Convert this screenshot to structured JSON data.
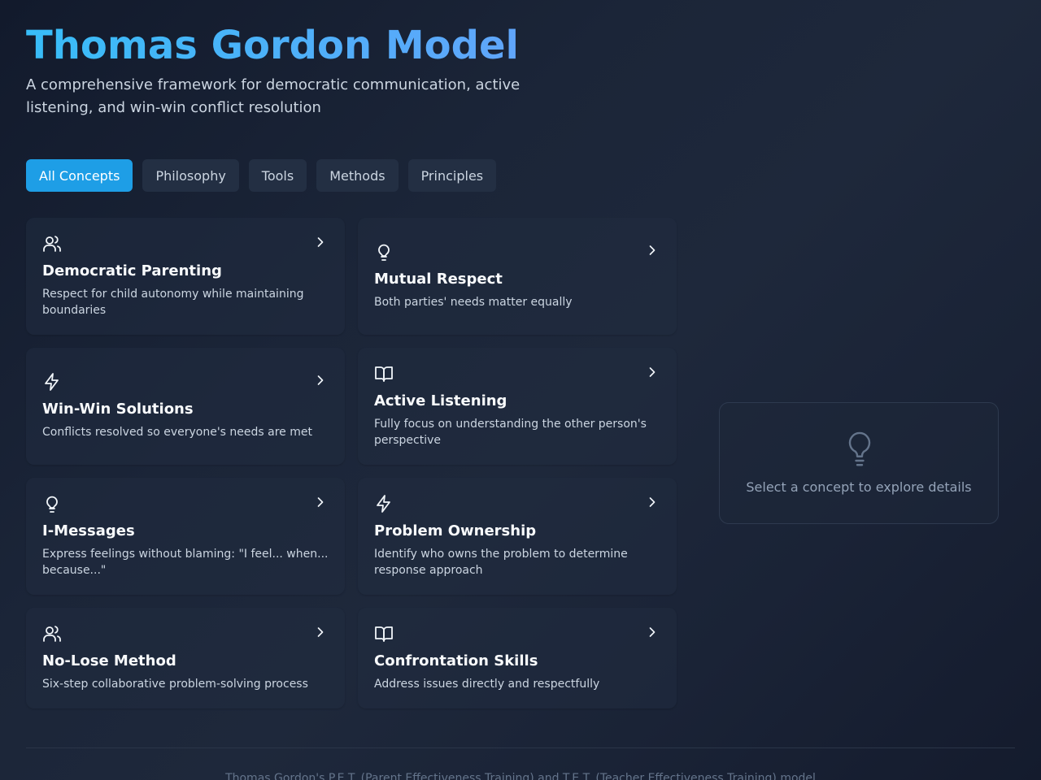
{
  "header": {
    "title": "Thomas Gordon Model",
    "subtitle": "A comprehensive framework for democratic communication, active listening, and win-win conflict resolution"
  },
  "filters": [
    {
      "label": "All Concepts",
      "active": true
    },
    {
      "label": "Philosophy",
      "active": false
    },
    {
      "label": "Tools",
      "active": false
    },
    {
      "label": "Methods",
      "active": false
    },
    {
      "label": "Principles",
      "active": false
    }
  ],
  "concepts": [
    {
      "title": "Democratic Parenting",
      "description": "Respect for child autonomy while maintaining boundaries",
      "icon": "users-icon"
    },
    {
      "title": "Mutual Respect",
      "description": "Both parties' needs matter equally",
      "icon": "lightbulb-icon"
    },
    {
      "title": "Win-Win Solutions",
      "description": "Conflicts resolved so everyone's needs are met",
      "icon": "lightning-icon"
    },
    {
      "title": "Active Listening",
      "description": "Fully focus on understanding the other person's perspective",
      "icon": "book-icon"
    },
    {
      "title": "I-Messages",
      "description": "Express feelings without blaming: \"I feel... when... because...\"",
      "icon": "lightbulb-icon"
    },
    {
      "title": "Problem Ownership",
      "description": "Identify who owns the problem to determine response approach",
      "icon": "lightning-icon"
    },
    {
      "title": "No-Lose Method",
      "description": "Six-step collaborative problem-solving process",
      "icon": "users-icon"
    },
    {
      "title": "Confrontation Skills",
      "description": "Address issues directly and respectfully",
      "icon": "book-icon"
    }
  ],
  "details_panel": {
    "placeholder": "Select a concept to explore details",
    "icon": "lightbulb-icon"
  },
  "footer": {
    "text": "Thomas Gordon's P.E.T. (Parent Effectiveness Training) and T.E.T. (Teacher Effectiveness Training) model"
  },
  "colors": {
    "accent": "#1e9ee6",
    "title_gradient_start": "#38bdf8",
    "title_gradient_end": "#60a5fa"
  }
}
